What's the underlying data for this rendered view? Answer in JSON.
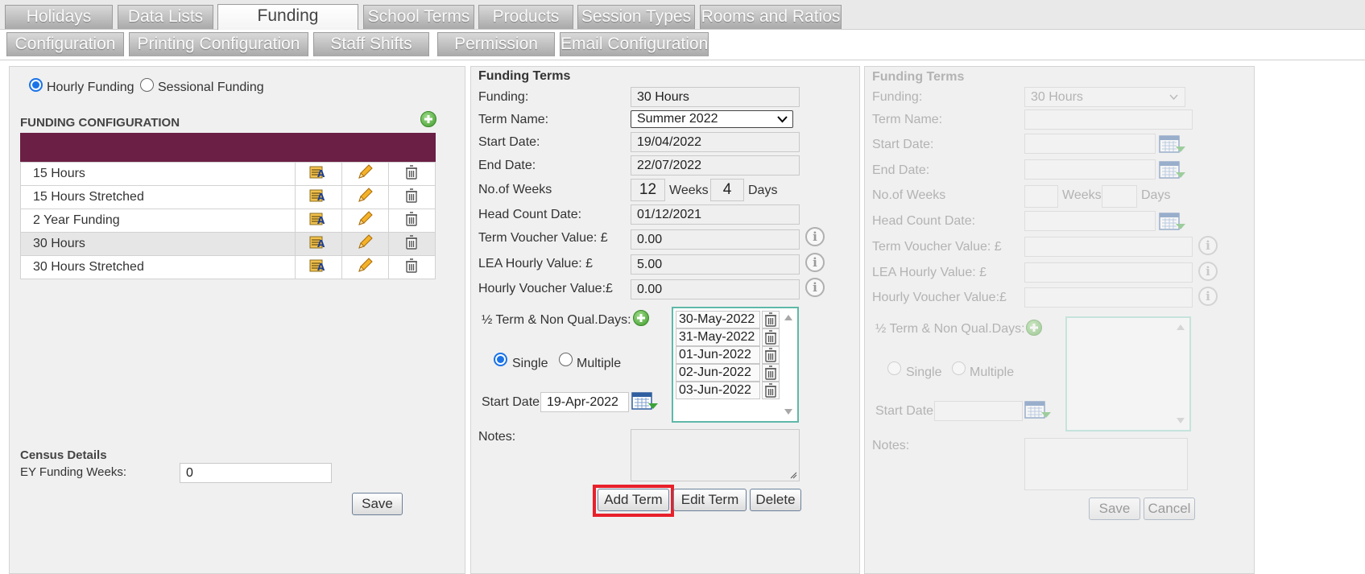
{
  "tabs_row1": [
    {
      "label": "Holidays",
      "active": false
    },
    {
      "label": "Data Lists",
      "active": false
    },
    {
      "label": "Funding",
      "active": true
    },
    {
      "label": "School Terms",
      "active": false
    },
    {
      "label": "Products",
      "active": false
    },
    {
      "label": "Session Types",
      "active": false
    },
    {
      "label": "Rooms and Ratios",
      "active": false
    }
  ],
  "tabs_row2": [
    {
      "label": "Configuration"
    },
    {
      "label": "Printing Configuration"
    },
    {
      "label": "Staff Shifts"
    },
    {
      "label": "Permission"
    },
    {
      "label": "Email Configuration"
    }
  ],
  "left": {
    "funding_mode": {
      "hourly_label": "Hourly Funding",
      "sessional_label": "Sessional Funding",
      "selected": "hourly"
    },
    "config_title": "FUNDING CONFIGURATION",
    "rows": [
      {
        "name": "15 Hours",
        "selected": false
      },
      {
        "name": "15 Hours Stretched",
        "selected": false
      },
      {
        "name": "2 Year Funding",
        "selected": false
      },
      {
        "name": "30 Hours",
        "selected": true
      },
      {
        "name": "30 Hours Stretched",
        "selected": false
      }
    ],
    "census_title": "Census Details",
    "ey_weeks_label": "EY Funding Weeks:",
    "ey_weeks_value": "0",
    "save_label": "Save"
  },
  "middle": {
    "title": "Funding Terms",
    "funding_label": "Funding:",
    "funding_value": "30 Hours",
    "term_name_label": "Term Name:",
    "term_name_value": "Summer 2022",
    "start_date_label": "Start Date:",
    "start_date_value": "19/04/2022",
    "end_date_label": "End Date:",
    "end_date_value": "22/07/2022",
    "weeks_label": "No.of Weeks",
    "weeks_value": "12",
    "weeks_unit": "Weeks",
    "days_value": "4",
    "days_unit": "Days",
    "head_count_label": "Head Count Date:",
    "head_count_value": "01/12/2021",
    "term_voucher_label": "Term Voucher Value: £",
    "term_voucher_value": "0.00",
    "lea_hourly_label": "LEA Hourly Value: £",
    "lea_hourly_value": "5.00",
    "hourly_voucher_label": "Hourly Voucher Value:£",
    "hourly_voucher_value": "0.00",
    "half_term_label": "½ Term & Non Qual.Days:",
    "single_label": "Single",
    "multiple_label": "Multiple",
    "day_mode": "single",
    "start_date2_label": "Start Date",
    "start_date2_value": "19-Apr-2022",
    "non_qual_days": [
      "30-May-2022",
      "31-May-2022",
      "01-Jun-2022",
      "02-Jun-2022",
      "03-Jun-2022"
    ],
    "notes_label": "Notes:",
    "add_term_label": "Add Term",
    "edit_term_label": "Edit Term",
    "delete_label": "Delete",
    "highlight_color": "#e8202a"
  },
  "right": {
    "title": "Funding Terms",
    "funding_label": "Funding:",
    "funding_value": "30 Hours",
    "term_name_label": "Term Name:",
    "start_date_label": "Start Date:",
    "end_date_label": "End Date:",
    "weeks_label": "No.of Weeks",
    "weeks_unit": "Weeks",
    "days_unit": "Days",
    "head_count_label": "Head Count Date:",
    "term_voucher_label": "Term Voucher Value: £",
    "lea_hourly_label": "LEA Hourly Value: £",
    "hourly_voucher_label": "Hourly Voucher Value:£",
    "half_term_label": "½ Term & Non Qual.Days:",
    "single_label": "Single",
    "multiple_label": "Multiple",
    "start_date2_label": "Start Date",
    "notes_label": "Notes:",
    "save_label": "Save",
    "cancel_label": "Cancel"
  },
  "colors": {
    "header_band": "#6b1f45",
    "list_border": "#5fb8a8",
    "button_border": "#6b7f99"
  }
}
